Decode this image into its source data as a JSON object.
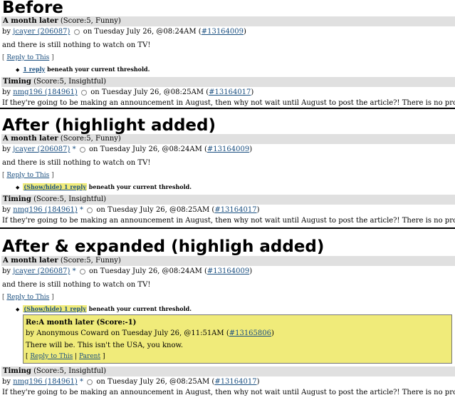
{
  "before": {
    "heading": "Before",
    "c1": {
      "title": "A month later",
      "score": "(Score:5, Funny)",
      "by": "by",
      "user": "jcayer (206087)",
      "date": "on Tuesday July 26, @08:24AM (",
      "id": "#13164009",
      "close": ")",
      "body": "and there is still nothing to watch on TV!",
      "reply": "Reply to This",
      "threshold_link": "1 reply",
      "threshold_rest": "beneath your current threshold."
    },
    "c2": {
      "title": "Timing",
      "score": "(Score:5, Insightful)",
      "by": "by",
      "user": "nmg196 (184961)",
      "date": "on Tuesday July 26, @08:25AM (",
      "id": "#13164017",
      "close": ")",
      "body": "If they're going to be making an announcement in August, then why not wait until August to post the article?! There is no product and no"
    }
  },
  "after": {
    "heading": "After (highlight added)",
    "c1": {
      "title": "A month later",
      "score": "(Score:5, Funny)",
      "by": "by",
      "user": "jcayer (206087)",
      "star": "*",
      "date": "on Tuesday July 26, @08:24AM (",
      "id": "#13164009",
      "close": ")",
      "body": "and there is still nothing to watch on TV!",
      "reply": "Reply to This",
      "threshold_link": "(Show/hide) 1 reply",
      "threshold_rest": "beneath your current threshold."
    },
    "c2": {
      "title": "Timing",
      "score": "(Score:5, Insightful)",
      "by": "by",
      "user": "nmg196 (184961)",
      "star": "*",
      "date": "on Tuesday July 26, @08:25AM (",
      "id": "#13164017",
      "close": ")",
      "body": "If they're going to be making an announcement in August, then why not wait until August to post the article?! There is no product and no"
    }
  },
  "expanded": {
    "heading": "After & expanded (highligh added)",
    "c1": {
      "title": "A month later",
      "score": "(Score:5, Funny)",
      "by": "by",
      "user": "jcayer (206087)",
      "star": "*",
      "date": "on Tuesday July 26, @08:24AM (",
      "id": "#13164009",
      "close": ")",
      "body": "and there is still nothing to watch on TV!",
      "reply": "Reply to This",
      "threshold_link": "(Show/hide) 1 reply",
      "threshold_rest": "beneath your current threshold."
    },
    "reply": {
      "title": "Re:A month later",
      "score": "(Score:-1)",
      "byline": "by Anonymous Coward on Tuesday July 26, @11:51AM (",
      "id": "#13165806",
      "close": ")",
      "body": "There will be. This isn't the USA, you know.",
      "reply_link": "Reply to This",
      "parent_link": "Parent"
    },
    "c2": {
      "title": "Timing",
      "score": "(Score:5, Insightful)",
      "by": "by",
      "user": "nmg196 (184961)",
      "star": "*",
      "date": "on Tuesday July 26, @08:25AM (",
      "id": "#13164017",
      "close": ")",
      "body": "If they're going to be making an announcement in August, then why not wait until August to post the article?! There is no product and no"
    }
  },
  "colors": {
    "highlight": "#f0eb7a",
    "bar": "#e0e0e0",
    "link": "#1a4f80"
  },
  "icons": [
    "comment-icon"
  ]
}
